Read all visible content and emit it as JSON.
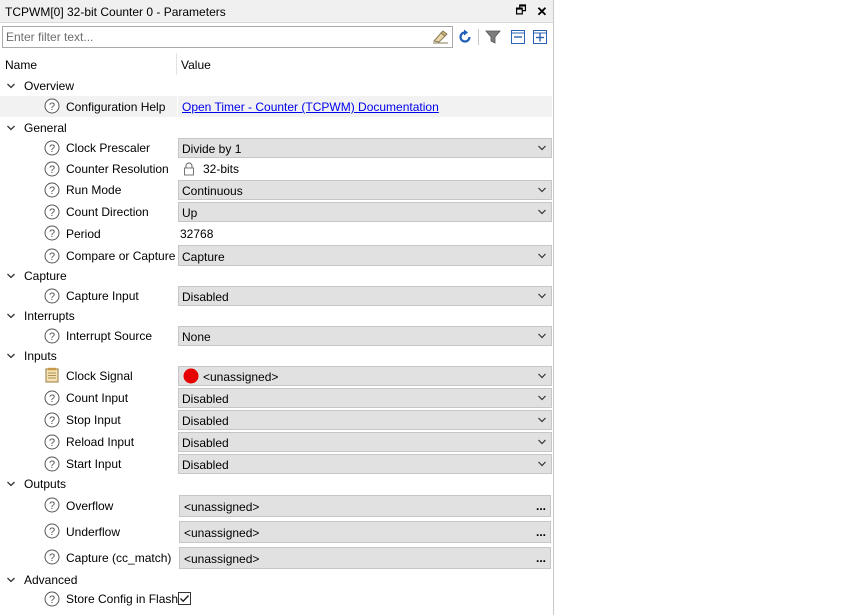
{
  "window": {
    "title": "TCPWM[0] 32-bit Counter 0 - Parameters",
    "float_glyph": "🗗",
    "close_glyph": "✕"
  },
  "toolbar": {
    "filter_placeholder": "Enter filter text...",
    "filter_value": ""
  },
  "columns": {
    "name": "Name",
    "value": "Value"
  },
  "sections": {
    "overview": {
      "label": "Overview",
      "configuration_help": {
        "name": "Configuration Help",
        "link": "Open Timer - Counter (TCPWM) Documentation"
      }
    },
    "general": {
      "label": "General",
      "clock_prescaler": {
        "name": "Clock Prescaler",
        "value": "Divide by 1"
      },
      "counter_resolution": {
        "name": "Counter Resolution",
        "value": "32-bits"
      },
      "run_mode": {
        "name": "Run Mode",
        "value": "Continuous"
      },
      "count_direction": {
        "name": "Count Direction",
        "value": "Up"
      },
      "period": {
        "name": "Period",
        "value": "32768"
      },
      "compare_or_capture": {
        "name": "Compare or Capture",
        "value": "Capture"
      }
    },
    "capture": {
      "label": "Capture",
      "capture_input": {
        "name": "Capture Input",
        "value": "Disabled"
      }
    },
    "interrupts": {
      "label": "Interrupts",
      "interrupt_source": {
        "name": "Interrupt Source",
        "value": "None"
      }
    },
    "inputs": {
      "label": "Inputs",
      "clock_signal": {
        "name": "Clock Signal",
        "value": "<unassigned>",
        "status_color": "#e60000"
      },
      "count_input": {
        "name": "Count Input",
        "value": "Disabled"
      },
      "stop_input": {
        "name": "Stop Input",
        "value": "Disabled"
      },
      "reload_input": {
        "name": "Reload Input",
        "value": "Disabled"
      },
      "start_input": {
        "name": "Start Input",
        "value": "Disabled"
      }
    },
    "outputs": {
      "label": "Outputs",
      "overflow": {
        "name": "Overflow",
        "value": "<unassigned>",
        "button": "..."
      },
      "underflow": {
        "name": "Underflow",
        "value": "<unassigned>",
        "button": "..."
      },
      "capture_cc_match": {
        "name": "Capture (cc_match)",
        "value": "<unassigned>",
        "button": "..."
      }
    },
    "advanced": {
      "label": "Advanced",
      "store_config_in_flash": {
        "name": "Store Config in Flash",
        "checked": true
      }
    }
  },
  "colors": {
    "link": "#0000ee",
    "dropdown_bg": "#e1e1e1",
    "error_dot": "#e60000"
  }
}
